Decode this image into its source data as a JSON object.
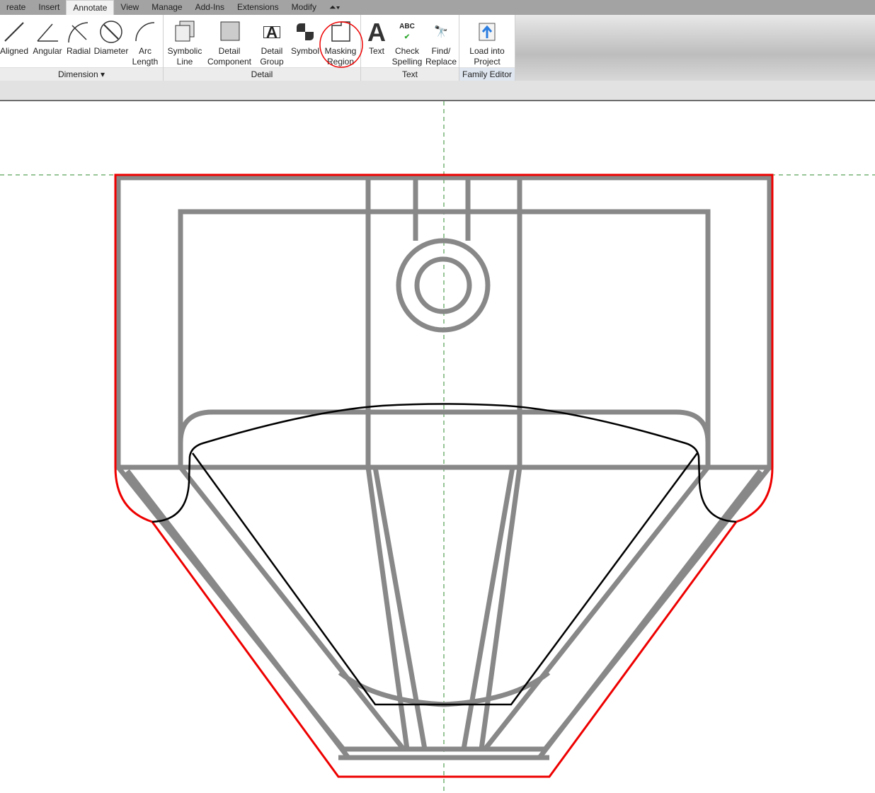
{
  "tabs": [
    "reate",
    "Insert",
    "Annotate",
    "View",
    "Manage",
    "Add-Ins",
    "Extensions",
    "Modify"
  ],
  "active_tab": "Annotate",
  "panels": {
    "dimension": {
      "label": "Dimension ▾",
      "buttons": [
        "Aligned",
        "Angular",
        "Radial",
        "Diameter",
        "Arc\nLength"
      ]
    },
    "detail": {
      "label": "Detail",
      "buttons": [
        "Symbolic\nLine",
        "Detail\nComponent",
        "Detail\nGroup",
        "Symbol",
        "Masking\nRegion"
      ]
    },
    "text": {
      "label": "Text",
      "buttons": [
        "Text",
        "Check\nSpelling",
        "Find/\nReplace"
      ]
    },
    "family_editor": {
      "label": "Family Editor",
      "buttons": [
        "Load into\nProject"
      ]
    }
  },
  "colors": {
    "outline": "#e00000",
    "geometry": "#888888",
    "mask": "#000000",
    "refplane": "#2e8b2e"
  }
}
